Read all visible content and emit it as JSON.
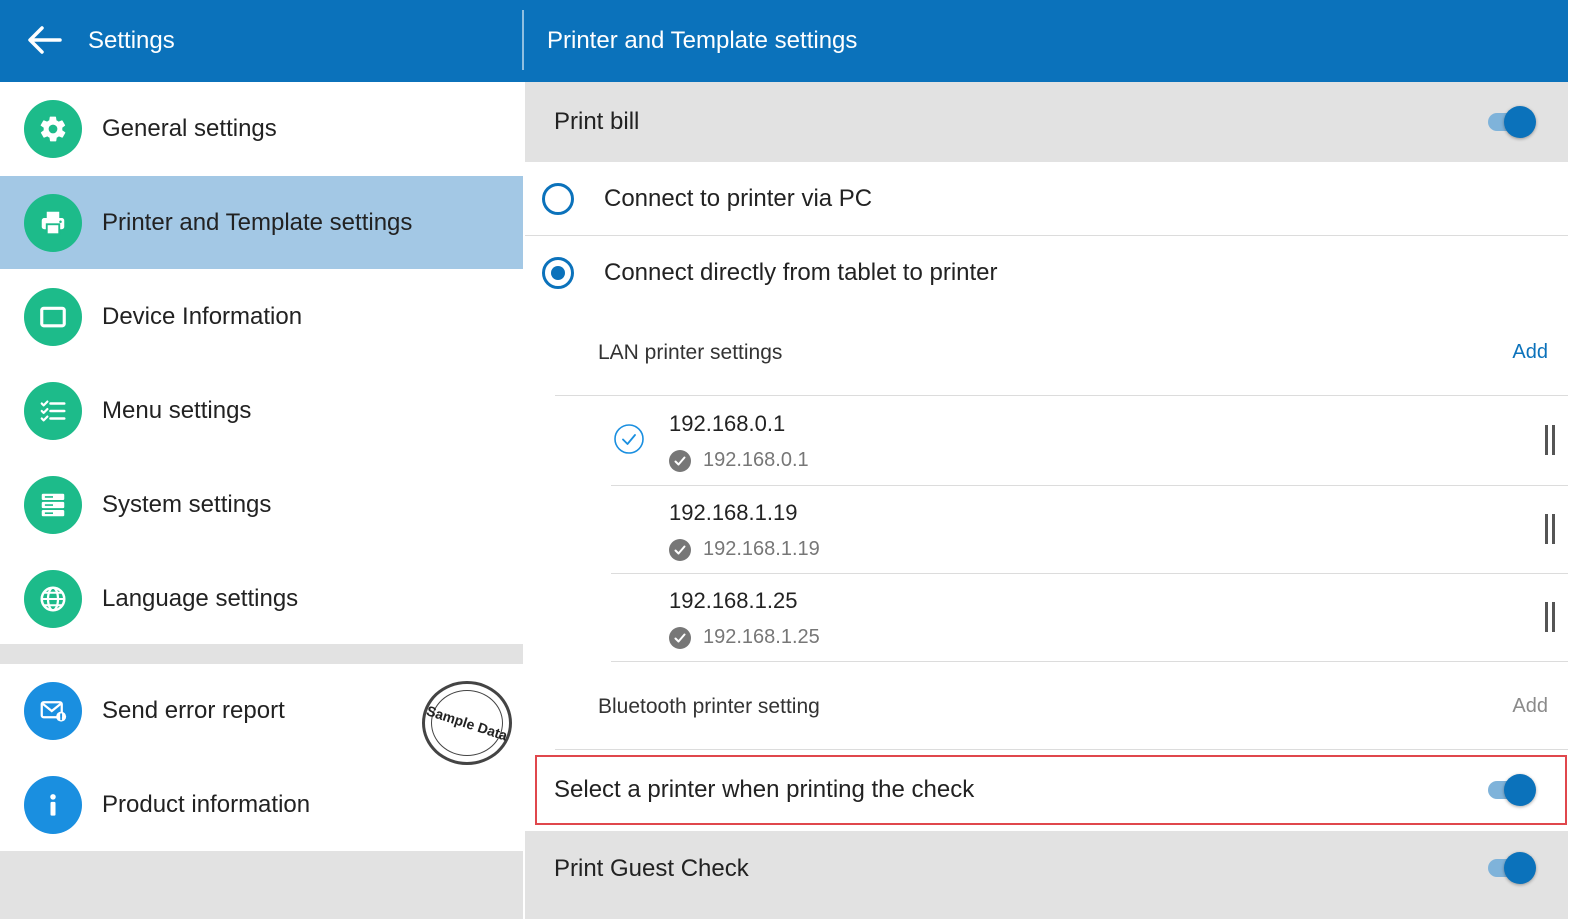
{
  "header": {
    "title": "Settings",
    "page_title": "Printer and Template settings"
  },
  "sidebar": {
    "items": [
      {
        "label": "General settings",
        "icon": "gear-icon"
      },
      {
        "label": "Printer and Template settings",
        "icon": "printer-icon",
        "active": true
      },
      {
        "label": "Device Information",
        "icon": "device-icon"
      },
      {
        "label": "Menu settings",
        "icon": "checklist-icon"
      },
      {
        "label": "System settings",
        "icon": "server-icon"
      },
      {
        "label": "Language settings",
        "icon": "globe-icon"
      }
    ],
    "support_items": [
      {
        "label": "Send error report",
        "icon": "mail-icon"
      },
      {
        "label": "Product information",
        "icon": "info-icon"
      }
    ],
    "stamp": "Sample Data"
  },
  "main": {
    "print_bill": {
      "label": "Print bill",
      "on": true
    },
    "connection_options": [
      {
        "label": "Connect to printer via PC",
        "selected": false
      },
      {
        "label": "Connect directly from tablet to printer",
        "selected": true
      }
    ],
    "lan": {
      "title": "LAN printer settings",
      "add_label": "Add",
      "printers": [
        {
          "ip": "192.168.0.1",
          "address": "192.168.0.1",
          "selected": true
        },
        {
          "ip": "192.168.1.19",
          "address": "192.168.1.19",
          "selected": false
        },
        {
          "ip": "192.168.1.25",
          "address": "192.168.1.25",
          "selected": false
        }
      ]
    },
    "bluetooth": {
      "title": "Bluetooth printer setting",
      "add_label": "Add"
    },
    "select_printer": {
      "label": "Select a printer when printing the check",
      "on": true
    },
    "print_guest_check": {
      "label": "Print Guest Check",
      "on": true
    }
  },
  "colors": {
    "brand_blue": "#0b72bb",
    "icon_green": "#1dbb8a",
    "icon_blue": "#1a8fe0",
    "active_row": "#a3c8e5",
    "highlight": "#e0474c",
    "add_active": "#0b72bb",
    "add_disabled": "#8a8a8a"
  }
}
